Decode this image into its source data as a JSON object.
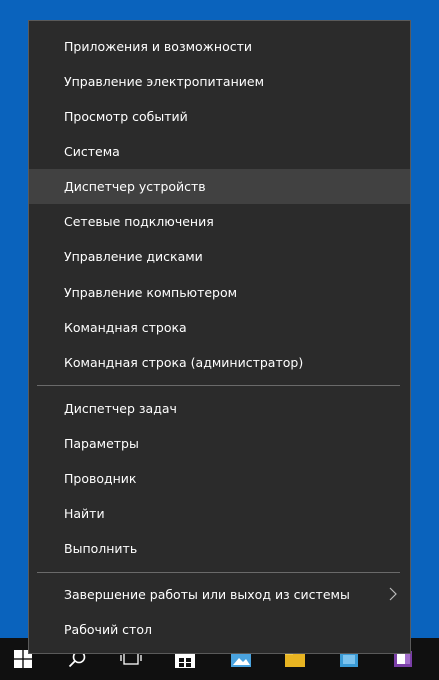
{
  "menu": {
    "group1": [
      {
        "label": "Приложения и возможности"
      },
      {
        "label": "Управление электропитанием"
      },
      {
        "label": "Просмотр событий"
      },
      {
        "label": "Система"
      },
      {
        "label": "Диспетчер устройств"
      },
      {
        "label": "Сетевые подключения"
      },
      {
        "label": "Управление дисками"
      },
      {
        "label": "Управление компьютером"
      },
      {
        "label": "Командная строка"
      },
      {
        "label": "Командная строка (администратор)"
      }
    ],
    "group2": [
      {
        "label": "Диспетчер задач"
      },
      {
        "label": "Параметры"
      },
      {
        "label": "Проводник"
      },
      {
        "label": "Найти"
      },
      {
        "label": "Выполнить"
      }
    ],
    "group3": [
      {
        "label": "Завершение работы или выход из системы",
        "submenu_icon": "chevron-right-icon"
      },
      {
        "label": "Рабочий стол"
      }
    ],
    "hovered_item": "Диспетчер устройств"
  },
  "taskbar": {
    "icons": [
      "windows-logo-icon",
      "search-icon",
      "task-view-icon",
      "store-icon",
      "photos-icon",
      "file-explorer-icon",
      "outlook-icon",
      "onenote-icon"
    ]
  },
  "colors": {
    "desktop": "#0a63bd",
    "menu_background": "#2b2b2b",
    "menu_hover": "#414141",
    "taskbar": "#101010"
  }
}
